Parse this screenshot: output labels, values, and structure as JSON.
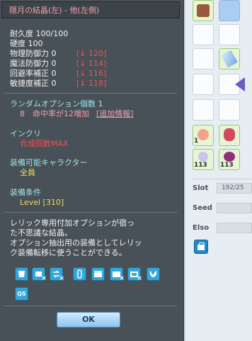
{
  "tooltip": {
    "title": "隠月の結晶(左) - 他(左側)",
    "stats": [
      {
        "label": "耐久度 100/100",
        "bracket": ""
      },
      {
        "label": "硬度 100",
        "bracket": ""
      },
      {
        "label": "物理防御力 0",
        "bracket": "[↓ 120]"
      },
      {
        "label": "魔法防御力 0",
        "bracket": "[↓ 114]"
      },
      {
        "label": "回避率補正 0",
        "bracket": "[↓ 116]"
      },
      {
        "label": "敏捷度補正 0",
        "bracket": "[↓ 118]"
      }
    ],
    "random_option_header": "ランダムオプション個数 1",
    "random_option_line": "8　命中率が12増加",
    "random_option_link": "[追加情報]",
    "inkuri_header": "インクリ",
    "inkuri_value": "合成回数MAX",
    "equip_char_header": "装備可能キャラクター",
    "equip_char_value": "全員",
    "equip_cond_header": "装備条件",
    "equip_cond_value": "Level [310]",
    "description": [
      "レリック専用付加オプションが宿っ",
      "た不思議な結晶。",
      "オプション抽出用の装備としてレリッ",
      "ク装備転移に使うことができる。"
    ],
    "qs_label": "QS",
    "ok_label": "OK"
  },
  "inventory": {
    "slot_label": "Slot",
    "slot_value": "192/25",
    "seed_label": "Seed",
    "elso_label": "Elso",
    "item_counts": [
      "1",
      "113",
      "113"
    ]
  },
  "colors": {
    "panel_bg": "#485157",
    "title_text": "#f0a0aa",
    "value_text": "#eddc56",
    "penalty_text": "#ef5353",
    "ok_button": "#a8d4f5"
  }
}
